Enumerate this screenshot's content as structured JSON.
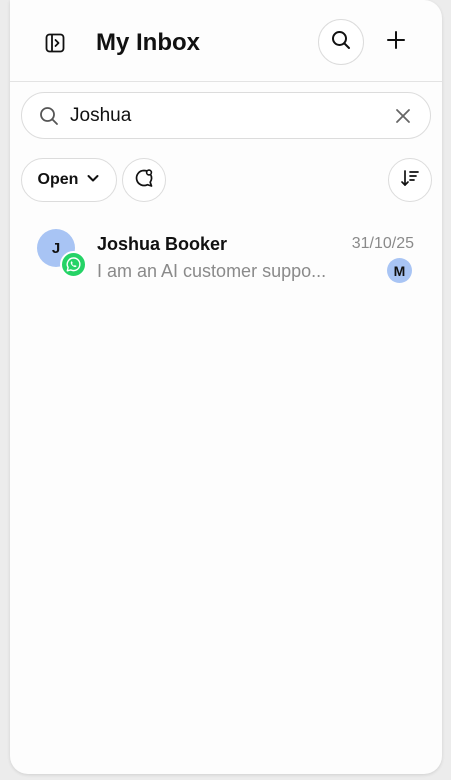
{
  "header": {
    "title": "My Inbox",
    "icons": {
      "sidebar_toggle": "sidebar-toggle-icon",
      "search": "search-icon",
      "add": "plus-icon"
    }
  },
  "search": {
    "value": "Joshua",
    "placeholder": "",
    "icon": "search-icon",
    "clear_icon": "close-icon"
  },
  "filters": {
    "status_label": "Open",
    "status_icon": "chevron-down-icon",
    "chat_filter_icon": "chat-bubble-icon",
    "sort_icon": "sort-icon"
  },
  "conversations": [
    {
      "avatar_initial": "J",
      "avatar_color": "#a8c4f4",
      "channel": "whatsapp",
      "channel_color": "#25d366",
      "name": "Joshua Booker",
      "date": "31/10/25",
      "preview": "I am an AI customer suppo...",
      "assignee_initial": "M",
      "assignee_color": "#a8c4f4"
    }
  ]
}
